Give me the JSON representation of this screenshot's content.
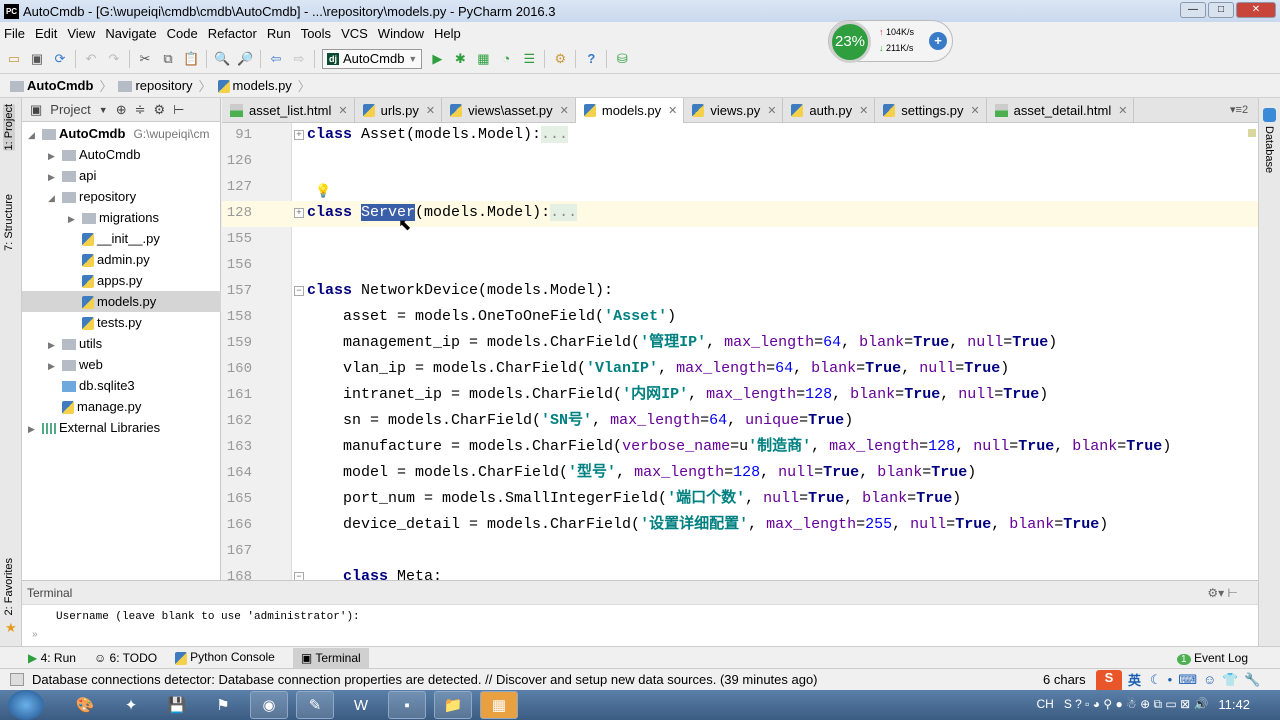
{
  "window": {
    "title": "AutoCmdb - [G:\\wupeiqi\\cmdb\\cmdb\\AutoCmdb] - ...\\repository\\models.py - PyCharm 2016.3",
    "logo": "PC"
  },
  "menu": [
    "File",
    "Edit",
    "View",
    "Navigate",
    "Code",
    "Refactor",
    "Run",
    "Tools",
    "VCS",
    "Window",
    "Help"
  ],
  "toolbar": {
    "run_config": "AutoCmdb",
    "dj_badge": "dj"
  },
  "net_widget": {
    "percent": "23%",
    "upload": "104K/s",
    "download": "211K/s"
  },
  "breadcrumb": [
    "AutoCmdb",
    "repository",
    "models.py"
  ],
  "side_tabs": {
    "project": "1: Project",
    "structure": "7: Structure",
    "favorites": "2: Favorites",
    "database": "Database"
  },
  "project": {
    "header": "Project",
    "tree": [
      {
        "label": "AutoCmdb",
        "path": "G:\\wupeiqi\\cm",
        "depth": 0,
        "expanded": true,
        "type": "folder"
      },
      {
        "label": "AutoCmdb",
        "depth": 1,
        "expanded": false,
        "type": "folder"
      },
      {
        "label": "api",
        "depth": 1,
        "expanded": false,
        "type": "folder"
      },
      {
        "label": "repository",
        "depth": 1,
        "expanded": true,
        "type": "folder"
      },
      {
        "label": "migrations",
        "depth": 2,
        "expanded": false,
        "type": "folder"
      },
      {
        "label": "__init__.py",
        "depth": 2,
        "type": "py"
      },
      {
        "label": "admin.py",
        "depth": 2,
        "type": "py"
      },
      {
        "label": "apps.py",
        "depth": 2,
        "type": "py"
      },
      {
        "label": "models.py",
        "depth": 2,
        "type": "py",
        "selected": true
      },
      {
        "label": "tests.py",
        "depth": 2,
        "type": "py"
      },
      {
        "label": "utils",
        "depth": 1,
        "expanded": false,
        "type": "folder"
      },
      {
        "label": "web",
        "depth": 1,
        "expanded": false,
        "type": "folder"
      },
      {
        "label": "db.sqlite3",
        "depth": 1,
        "type": "db"
      },
      {
        "label": "manage.py",
        "depth": 1,
        "type": "py"
      },
      {
        "label": "External Libraries",
        "depth": 0,
        "expanded": false,
        "type": "lib"
      }
    ]
  },
  "tabs": [
    {
      "label": "asset_list.html",
      "type": "html"
    },
    {
      "label": "urls.py",
      "type": "py"
    },
    {
      "label": "views\\asset.py",
      "type": "py"
    },
    {
      "label": "models.py",
      "type": "py",
      "active": true
    },
    {
      "label": "views.py",
      "type": "py"
    },
    {
      "label": "auth.py",
      "type": "py"
    },
    {
      "label": "settings.py",
      "type": "py"
    },
    {
      "label": "asset_detail.html",
      "type": "html"
    }
  ],
  "tabs_overflow": "2",
  "code": [
    {
      "n": "91",
      "fold": "+",
      "t": [
        [
          "class",
          "kw"
        ],
        [
          " Asset(models.Model):",
          ""
        ],
        [
          "...",
          "fold"
        ]
      ]
    },
    {
      "n": "126",
      "t": []
    },
    {
      "n": "127",
      "t": []
    },
    {
      "n": "128",
      "fold": "+",
      "cur": true,
      "t": [
        [
          "class",
          "kw"
        ],
        [
          " ",
          ""
        ],
        [
          "Server",
          "hl"
        ],
        [
          "(models.Model):",
          ""
        ],
        [
          "...",
          "fold"
        ]
      ]
    },
    {
      "n": "155",
      "t": []
    },
    {
      "n": "156",
      "t": []
    },
    {
      "n": "157",
      "fold": "-",
      "t": [
        [
          "class",
          "kw"
        ],
        [
          " NetworkDevice(models.Model):",
          ""
        ]
      ]
    },
    {
      "n": "158",
      "t": [
        [
          "    asset = models.OneToOneField(",
          ""
        ],
        [
          "'Asset'",
          "str"
        ],
        [
          ")",
          ""
        ]
      ]
    },
    {
      "n": "159",
      "t": [
        [
          "    management_ip = models.CharField(",
          ""
        ],
        [
          "'管理IP'",
          "str"
        ],
        [
          ", ",
          ""
        ],
        [
          "max_length",
          "kwarg"
        ],
        [
          "=",
          ""
        ],
        [
          "64",
          "num"
        ],
        [
          ", ",
          ""
        ],
        [
          "blank",
          "kwarg"
        ],
        [
          "=",
          ""
        ],
        [
          "True",
          "kw"
        ],
        [
          ", ",
          ""
        ],
        [
          "null",
          "kwarg"
        ],
        [
          "=",
          ""
        ],
        [
          "True",
          "kw"
        ],
        [
          ")",
          ""
        ]
      ]
    },
    {
      "n": "160",
      "t": [
        [
          "    vlan_ip = models.CharField(",
          ""
        ],
        [
          "'VlanIP'",
          "str"
        ],
        [
          ", ",
          ""
        ],
        [
          "max_length",
          "kwarg"
        ],
        [
          "=",
          ""
        ],
        [
          "64",
          "num"
        ],
        [
          ", ",
          ""
        ],
        [
          "blank",
          "kwarg"
        ],
        [
          "=",
          ""
        ],
        [
          "True",
          "kw"
        ],
        [
          ", ",
          ""
        ],
        [
          "null",
          "kwarg"
        ],
        [
          "=",
          ""
        ],
        [
          "True",
          "kw"
        ],
        [
          ")",
          ""
        ]
      ]
    },
    {
      "n": "161",
      "t": [
        [
          "    intranet_ip = models.CharField(",
          ""
        ],
        [
          "'内网IP'",
          "str"
        ],
        [
          ", ",
          ""
        ],
        [
          "max_length",
          "kwarg"
        ],
        [
          "=",
          ""
        ],
        [
          "128",
          "num"
        ],
        [
          ", ",
          ""
        ],
        [
          "blank",
          "kwarg"
        ],
        [
          "=",
          ""
        ],
        [
          "True",
          "kw"
        ],
        [
          ", ",
          ""
        ],
        [
          "null",
          "kwarg"
        ],
        [
          "=",
          ""
        ],
        [
          "True",
          "kw"
        ],
        [
          ")",
          ""
        ]
      ]
    },
    {
      "n": "162",
      "t": [
        [
          "    sn = models.CharField(",
          ""
        ],
        [
          "'SN号'",
          "str"
        ],
        [
          ", ",
          ""
        ],
        [
          "max_length",
          "kwarg"
        ],
        [
          "=",
          ""
        ],
        [
          "64",
          "num"
        ],
        [
          ", ",
          ""
        ],
        [
          "unique",
          "kwarg"
        ],
        [
          "=",
          ""
        ],
        [
          "True",
          "kw"
        ],
        [
          ")",
          ""
        ]
      ]
    },
    {
      "n": "163",
      "t": [
        [
          "    manufacture = models.CharField(",
          ""
        ],
        [
          "verbose_name",
          "kwarg"
        ],
        [
          "=u",
          ""
        ],
        [
          "'制造商'",
          "str"
        ],
        [
          ", ",
          ""
        ],
        [
          "max_length",
          "kwarg"
        ],
        [
          "=",
          ""
        ],
        [
          "128",
          "num"
        ],
        [
          ", ",
          ""
        ],
        [
          "null",
          "kwarg"
        ],
        [
          "=",
          ""
        ],
        [
          "True",
          "kw"
        ],
        [
          ", ",
          ""
        ],
        [
          "blank",
          "kwarg"
        ],
        [
          "=",
          ""
        ],
        [
          "True",
          "kw"
        ],
        [
          ")",
          ""
        ]
      ]
    },
    {
      "n": "164",
      "t": [
        [
          "    model = models.CharField(",
          ""
        ],
        [
          "'型号'",
          "str"
        ],
        [
          ", ",
          ""
        ],
        [
          "max_length",
          "kwarg"
        ],
        [
          "=",
          ""
        ],
        [
          "128",
          "num"
        ],
        [
          ", ",
          ""
        ],
        [
          "null",
          "kwarg"
        ],
        [
          "=",
          ""
        ],
        [
          "True",
          "kw"
        ],
        [
          ", ",
          ""
        ],
        [
          "blank",
          "kwarg"
        ],
        [
          "=",
          ""
        ],
        [
          "True",
          "kw"
        ],
        [
          ")",
          ""
        ]
      ]
    },
    {
      "n": "165",
      "t": [
        [
          "    port_num = models.SmallIntegerField(",
          ""
        ],
        [
          "'端口个数'",
          "str"
        ],
        [
          ", ",
          ""
        ],
        [
          "null",
          "kwarg"
        ],
        [
          "=",
          ""
        ],
        [
          "True",
          "kw"
        ],
        [
          ", ",
          ""
        ],
        [
          "blank",
          "kwarg"
        ],
        [
          "=",
          ""
        ],
        [
          "True",
          "kw"
        ],
        [
          ")",
          ""
        ]
      ]
    },
    {
      "n": "166",
      "t": [
        [
          "    device_detail = models.CharField(",
          ""
        ],
        [
          "'设置详细配置'",
          "str"
        ],
        [
          ", ",
          ""
        ],
        [
          "max_length",
          "kwarg"
        ],
        [
          "=",
          ""
        ],
        [
          "255",
          "num"
        ],
        [
          ", ",
          ""
        ],
        [
          "null",
          "kwarg"
        ],
        [
          "=",
          ""
        ],
        [
          "True",
          "kw"
        ],
        [
          ", ",
          ""
        ],
        [
          "blank",
          "kwarg"
        ],
        [
          "=",
          ""
        ],
        [
          "True",
          "kw"
        ],
        [
          ")",
          ""
        ]
      ]
    },
    {
      "n": "167",
      "t": []
    },
    {
      "n": "168",
      "fold": "-",
      "t": [
        [
          "    ",
          ""
        ],
        [
          "class",
          "kw"
        ],
        [
          " Meta:",
          ""
        ]
      ]
    }
  ],
  "terminal": {
    "title": "Terminal",
    "output": "Username (leave blank to use 'administrator'):",
    "prompt": "»"
  },
  "tool_windows": [
    {
      "label": "4: Run"
    },
    {
      "label": "6: TODO"
    },
    {
      "label": "Python Console"
    },
    {
      "label": "Terminal",
      "active": true
    }
  ],
  "event_log": {
    "count": "1",
    "label": "Event Log"
  },
  "status": {
    "message": "Database connections detector: Database connection properties are detected. // Discover and setup new data sources. (39 minutes ago)",
    "chars": "6 chars",
    "ime": "英"
  },
  "taskbar": {
    "lang": "CH",
    "clock": "11:42"
  }
}
